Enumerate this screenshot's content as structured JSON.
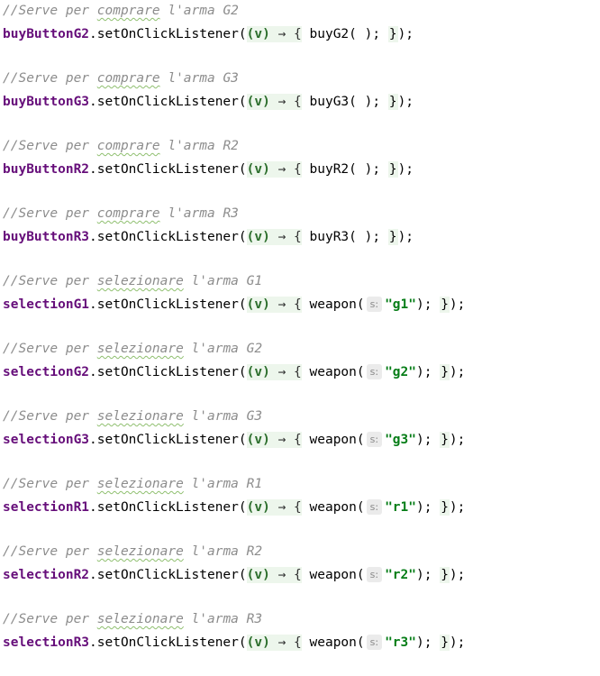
{
  "code_blocks": [
    {
      "comment_prefix": "//Serve per ",
      "comment_verb": "comprare",
      "comment_suffix": " l'arma G2",
      "target": "buyButtonG2",
      "call": "buyG2",
      "hint": "",
      "argument": ""
    },
    {
      "comment_prefix": "//Serve per ",
      "comment_verb": "comprare",
      "comment_suffix": " l'arma G3",
      "target": "buyButtonG3",
      "call": "buyG3",
      "hint": "",
      "argument": ""
    },
    {
      "comment_prefix": "//Serve per ",
      "comment_verb": "comprare",
      "comment_suffix": " l'arma R2",
      "target": "buyButtonR2",
      "call": "buyR2",
      "hint": "",
      "argument": ""
    },
    {
      "comment_prefix": "//Serve per ",
      "comment_verb": "comprare",
      "comment_suffix": " l'arma R3",
      "target": "buyButtonR3",
      "call": "buyR3",
      "hint": "",
      "argument": ""
    },
    {
      "comment_prefix": "//Serve per ",
      "comment_verb": "selezionare",
      "comment_suffix": " l'arma G1",
      "target": "selectionG1",
      "call": "weapon",
      "hint": "s:",
      "argument": "\"g1\""
    },
    {
      "comment_prefix": "//Serve per ",
      "comment_verb": "selezionare",
      "comment_suffix": " l'arma G2",
      "target": "selectionG2",
      "call": "weapon",
      "hint": "s:",
      "argument": "\"g2\""
    },
    {
      "comment_prefix": "//Serve per ",
      "comment_verb": "selezionare",
      "comment_suffix": " l'arma G3",
      "target": "selectionG3",
      "call": "weapon",
      "hint": "s:",
      "argument": "\"g3\""
    },
    {
      "comment_prefix": "//Serve per ",
      "comment_verb": "selezionare",
      "comment_suffix": " l'arma R1",
      "target": "selectionR1",
      "call": "weapon",
      "hint": "s:",
      "argument": "\"r1\""
    },
    {
      "comment_prefix": "//Serve per ",
      "comment_verb": "selezionare",
      "comment_suffix": " l'arma R2",
      "target": "selectionR2",
      "call": "weapon",
      "hint": "s:",
      "argument": "\"r2\""
    },
    {
      "comment_prefix": "//Serve per ",
      "comment_verb": "selezionare",
      "comment_suffix": " l'arma R3",
      "target": "selectionR3",
      "call": "weapon",
      "hint": "s:",
      "argument": "\"r3\""
    }
  ],
  "syntax": {
    "method": ".setOnClickListener(",
    "lambda_open": "(v)",
    "arrow": " → {",
    "statement_end": "); ",
    "lambda_close": "}",
    "line_end": ");"
  },
  "colors": {
    "keyword_field": "#660e7a",
    "comment": "#8c8c8c",
    "string": "#067d17",
    "lambda_highlight": "#edf6ec",
    "hint_background": "#ebebeb"
  }
}
